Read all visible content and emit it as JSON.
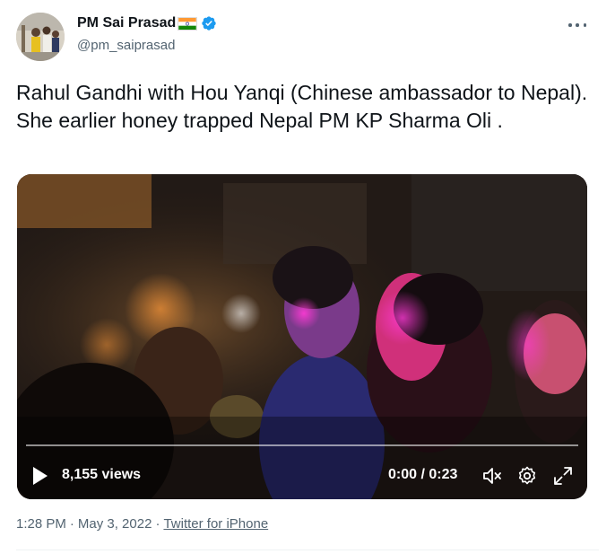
{
  "author": {
    "display_name": "PM Sai Prasad",
    "handle": "@pm_saiprasad",
    "verified": true
  },
  "tweet": {
    "text": "Rahul Gandhi with Hou Yanqi (Chinese ambassador to Nepal). She earlier honey trapped Nepal PM KP Sharma Oli ."
  },
  "video": {
    "views": "8,155 views",
    "time": "0:00 / 0:23",
    "progress": 0
  },
  "meta": {
    "time": "1:28 PM",
    "separator": "·",
    "date": "May 3, 2022",
    "source": "Twitter for iPhone"
  },
  "colors": {
    "text": "#0f1419",
    "secondary": "#536471",
    "verified": "#1d9bf0"
  },
  "icons": [
    "more-icon",
    "verified-badge-icon",
    "india-flag-icon",
    "play-icon",
    "volume-mute-icon",
    "settings-icon",
    "fullscreen-icon"
  ]
}
